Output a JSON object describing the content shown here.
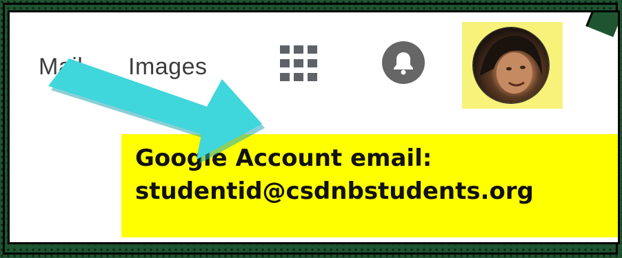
{
  "header": {
    "links": [
      {
        "label": "Mail"
      },
      {
        "label": "Images"
      }
    ]
  },
  "icons": {
    "apps": "apps-grid-icon",
    "notifications": "bell-icon",
    "account": "avatar"
  },
  "callout": {
    "line1": "Google Account email:",
    "line2": "studentid@csdnbstudents.org"
  },
  "colors": {
    "highlight": "#ffff00",
    "arrow": "#3fd6dc",
    "frame": "#1f5430"
  }
}
